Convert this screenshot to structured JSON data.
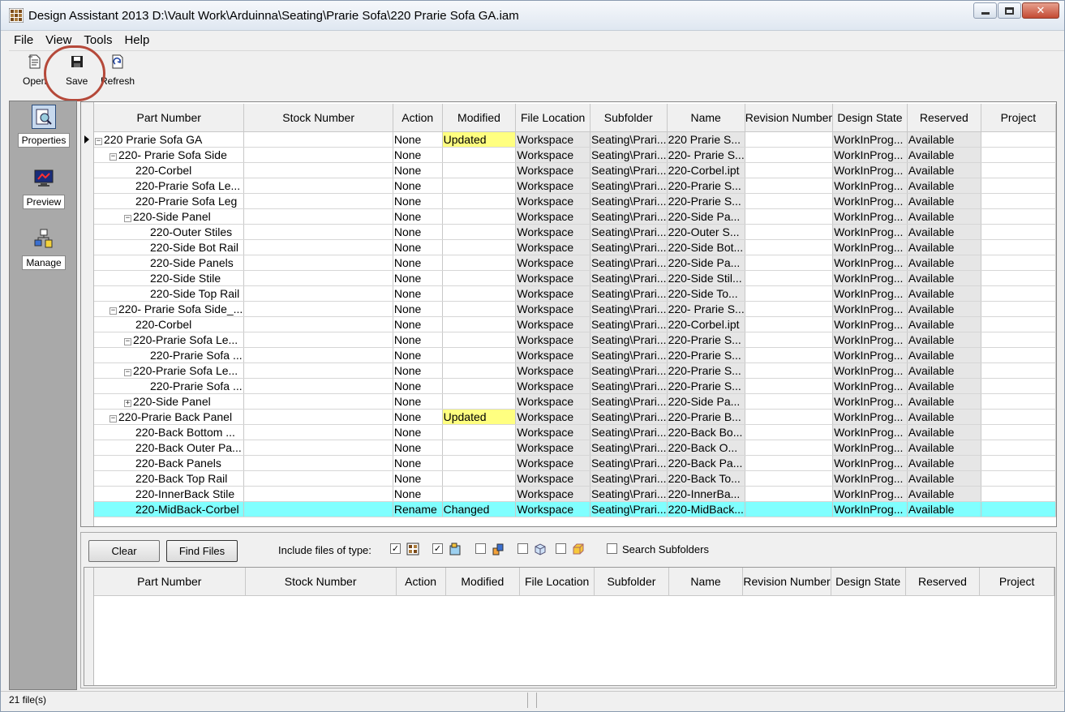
{
  "window": {
    "title": "Design Assistant 2013 D:\\Vault Work\\Arduinna\\Seating\\Prarie Sofa\\220 Prarie Sofa GA.iam"
  },
  "menu": [
    "File",
    "View",
    "Tools",
    "Help"
  ],
  "toolbar": {
    "open_label": "Open",
    "save_label": "Save",
    "refresh_label": "Refresh"
  },
  "leftnav": {
    "properties": "Properties",
    "preview": "Preview",
    "manage": "Manage"
  },
  "columns": [
    "Part Number",
    "Stock Number",
    "Action",
    "Modified",
    "File Location",
    "Subfolder",
    "Name",
    "Revision Number",
    "Design State",
    "Reserved",
    "Project"
  ],
  "rows": [
    {
      "part": "220 Prarie Sofa GA",
      "level": 0,
      "exp": "-",
      "action": "None",
      "modified": "Updated",
      "location": "Workspace",
      "subfolder": "Seating\\Prari...",
      "name": "220 Prarie S...",
      "state": "WorkInProg...",
      "reserved": "Available"
    },
    {
      "part": "220- Prarie Sofa Side",
      "level": 1,
      "exp": "-",
      "action": "None",
      "modified": "",
      "location": "Workspace",
      "subfolder": "Seating\\Prari...",
      "name": "220- Prarie S...",
      "state": "WorkInProg...",
      "reserved": "Available"
    },
    {
      "part": "220-Corbel",
      "level": 2,
      "exp": "",
      "action": "None",
      "modified": "",
      "location": "Workspace",
      "subfolder": "Seating\\Prari...",
      "name": "220-Corbel.ipt",
      "state": "WorkInProg...",
      "reserved": "Available"
    },
    {
      "part": "220-Prarie Sofa Le...",
      "level": 2,
      "exp": "",
      "action": "None",
      "modified": "",
      "location": "Workspace",
      "subfolder": "Seating\\Prari...",
      "name": "220-Prarie S...",
      "state": "WorkInProg...",
      "reserved": "Available"
    },
    {
      "part": "220-Prarie Sofa Leg",
      "level": 2,
      "exp": "",
      "action": "None",
      "modified": "",
      "location": "Workspace",
      "subfolder": "Seating\\Prari...",
      "name": "220-Prarie S...",
      "state": "WorkInProg...",
      "reserved": "Available"
    },
    {
      "part": "220-Side Panel",
      "level": 2,
      "exp": "-",
      "action": "None",
      "modified": "",
      "location": "Workspace",
      "subfolder": "Seating\\Prari...",
      "name": "220-Side Pa...",
      "state": "WorkInProg...",
      "reserved": "Available"
    },
    {
      "part": "220-Outer Stiles",
      "level": 3,
      "exp": "",
      "action": "None",
      "modified": "",
      "location": "Workspace",
      "subfolder": "Seating\\Prari...",
      "name": "220-Outer S...",
      "state": "WorkInProg...",
      "reserved": "Available"
    },
    {
      "part": "220-Side Bot Rail",
      "level": 3,
      "exp": "",
      "action": "None",
      "modified": "",
      "location": "Workspace",
      "subfolder": "Seating\\Prari...",
      "name": "220-Side Bot...",
      "state": "WorkInProg...",
      "reserved": "Available"
    },
    {
      "part": "220-Side Panels",
      "level": 3,
      "exp": "",
      "action": "None",
      "modified": "",
      "location": "Workspace",
      "subfolder": "Seating\\Prari...",
      "name": "220-Side Pa...",
      "state": "WorkInProg...",
      "reserved": "Available"
    },
    {
      "part": "220-Side Stile",
      "level": 3,
      "exp": "",
      "action": "None",
      "modified": "",
      "location": "Workspace",
      "subfolder": "Seating\\Prari...",
      "name": "220-Side Stil...",
      "state": "WorkInProg...",
      "reserved": "Available"
    },
    {
      "part": "220-Side Top Rail",
      "level": 3,
      "exp": "",
      "action": "None",
      "modified": "",
      "location": "Workspace",
      "subfolder": "Seating\\Prari...",
      "name": "220-Side To...",
      "state": "WorkInProg...",
      "reserved": "Available"
    },
    {
      "part": "220- Prarie Sofa Side_...",
      "level": 1,
      "exp": "-",
      "action": "None",
      "modified": "",
      "location": "Workspace",
      "subfolder": "Seating\\Prari...",
      "name": "220- Prarie S...",
      "state": "WorkInProg...",
      "reserved": "Available"
    },
    {
      "part": "220-Corbel",
      "level": 2,
      "exp": "",
      "action": "None",
      "modified": "",
      "location": "Workspace",
      "subfolder": "Seating\\Prari...",
      "name": "220-Corbel.ipt",
      "state": "WorkInProg...",
      "reserved": "Available"
    },
    {
      "part": "220-Prarie Sofa Le...",
      "level": 2,
      "exp": "-",
      "action": "None",
      "modified": "",
      "location": "Workspace",
      "subfolder": "Seating\\Prari...",
      "name": "220-Prarie S...",
      "state": "WorkInProg...",
      "reserved": "Available"
    },
    {
      "part": "220-Prarie Sofa ...",
      "level": 3,
      "exp": "",
      "action": "None",
      "modified": "",
      "location": "Workspace",
      "subfolder": "Seating\\Prari...",
      "name": "220-Prarie S...",
      "state": "WorkInProg...",
      "reserved": "Available"
    },
    {
      "part": "220-Prarie Sofa Le...",
      "level": 2,
      "exp": "-",
      "action": "None",
      "modified": "",
      "location": "Workspace",
      "subfolder": "Seating\\Prari...",
      "name": "220-Prarie S...",
      "state": "WorkInProg...",
      "reserved": "Available"
    },
    {
      "part": "220-Prarie Sofa ...",
      "level": 3,
      "exp": "",
      "action": "None",
      "modified": "",
      "location": "Workspace",
      "subfolder": "Seating\\Prari...",
      "name": "220-Prarie S...",
      "state": "WorkInProg...",
      "reserved": "Available"
    },
    {
      "part": "220-Side Panel",
      "level": 2,
      "exp": "+",
      "action": "None",
      "modified": "",
      "location": "Workspace",
      "subfolder": "Seating\\Prari...",
      "name": "220-Side Pa...",
      "state": "WorkInProg...",
      "reserved": "Available"
    },
    {
      "part": "220-Prarie Back Panel",
      "level": 1,
      "exp": "-",
      "action": "None",
      "modified": "Updated",
      "location": "Workspace",
      "subfolder": "Seating\\Prari...",
      "name": "220-Prarie B...",
      "state": "WorkInProg...",
      "reserved": "Available"
    },
    {
      "part": "220-Back Bottom ...",
      "level": 2,
      "exp": "",
      "action": "None",
      "modified": "",
      "location": "Workspace",
      "subfolder": "Seating\\Prari...",
      "name": "220-Back Bo...",
      "state": "WorkInProg...",
      "reserved": "Available"
    },
    {
      "part": "220-Back Outer Pa...",
      "level": 2,
      "exp": "",
      "action": "None",
      "modified": "",
      "location": "Workspace",
      "subfolder": "Seating\\Prari...",
      "name": "220-Back O...",
      "state": "WorkInProg...",
      "reserved": "Available"
    },
    {
      "part": "220-Back Panels",
      "level": 2,
      "exp": "",
      "action": "None",
      "modified": "",
      "location": "Workspace",
      "subfolder": "Seating\\Prari...",
      "name": "220-Back Pa...",
      "state": "WorkInProg...",
      "reserved": "Available"
    },
    {
      "part": "220-Back Top Rail",
      "level": 2,
      "exp": "",
      "action": "None",
      "modified": "",
      "location": "Workspace",
      "subfolder": "Seating\\Prari...",
      "name": "220-Back To...",
      "state": "WorkInProg...",
      "reserved": "Available"
    },
    {
      "part": "220-InnerBack Stile",
      "level": 2,
      "exp": "",
      "action": "None",
      "modified": "",
      "location": "Workspace",
      "subfolder": "Seating\\Prari...",
      "name": "220-InnerBa...",
      "state": "WorkInProg...",
      "reserved": "Available"
    },
    {
      "part": "220-MidBack-Corbel",
      "level": 2,
      "exp": "",
      "action": "Rename",
      "modified": "Changed",
      "location": "Workspace",
      "subfolder": "Seating\\Prari...",
      "name": "220-MidBack...",
      "state": "WorkInProg...",
      "reserved": "Available",
      "selected": true
    }
  ],
  "search": {
    "clear_label": "Clear",
    "find_label": "Find Files",
    "include_label": "Include files of type:",
    "filetypes": [
      {
        "icon": "assembly-icon",
        "checked": true
      },
      {
        "icon": "drawing-icon",
        "checked": true
      },
      {
        "icon": "presentation-icon",
        "checked": false
      },
      {
        "icon": "part-icon",
        "checked": false
      },
      {
        "icon": "sheetmetal-icon",
        "checked": false
      }
    ],
    "subfolders_label": "Search Subfolders",
    "subfolders_checked": false
  },
  "status": {
    "file_count": "21 file(s)"
  },
  "colors": {
    "updated": "#ffff80",
    "selected": "#80ffff",
    "highlight_ring": "#b5493a"
  }
}
